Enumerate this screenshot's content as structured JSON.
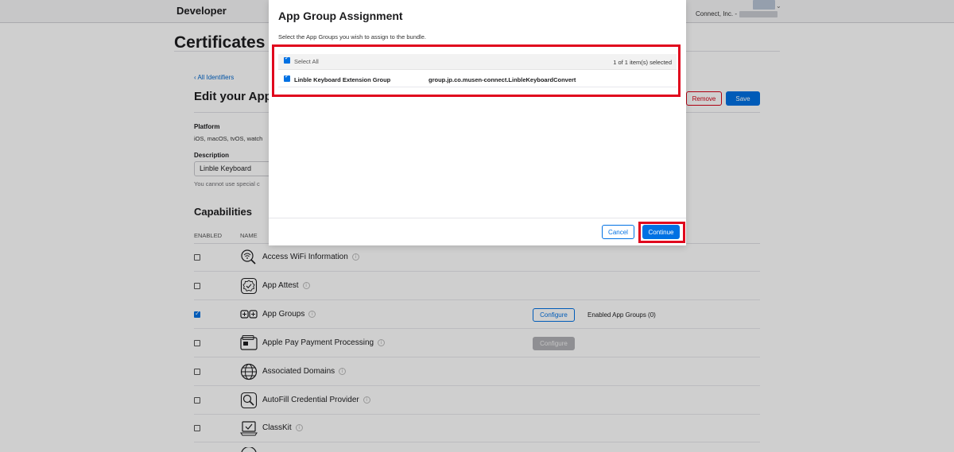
{
  "header": {
    "brand": "Developer",
    "account_text": "Connect, Inc. -"
  },
  "page": {
    "section_title": "Certificates",
    "back_link": "‹ All Identifiers",
    "edit_title": "Edit your App",
    "remove_label": "Remove",
    "save_label": "Save",
    "platform_label": "Platform",
    "platform_value": "iOS, macOS, tvOS, watch",
    "description_label": "Description",
    "description_value": "Linble Keyboard",
    "description_hint": "You cannot use special c",
    "capabilities_title": "Capabilities",
    "col_enabled": "ENABLED",
    "col_name": "NAME",
    "capabilities": [
      {
        "name": "Access WiFi Information",
        "enabled": false,
        "icon": "wifi-search-icon"
      },
      {
        "name": "App Attest",
        "enabled": false,
        "icon": "badge-check-icon"
      },
      {
        "name": "App Groups",
        "enabled": true,
        "icon": "app-groups-icon",
        "configure": "Configure",
        "extra": "Enabled App Groups (0)"
      },
      {
        "name": "Apple Pay Payment Processing",
        "enabled": false,
        "icon": "wallet-icon",
        "configure": "Configure",
        "configure_disabled": true
      },
      {
        "name": "Associated Domains",
        "enabled": false,
        "icon": "globe-icon"
      },
      {
        "name": "AutoFill Credential Provider",
        "enabled": false,
        "icon": "key-search-icon"
      },
      {
        "name": "ClassKit",
        "enabled": false,
        "icon": "classkit-icon"
      }
    ]
  },
  "modal": {
    "title": "App Group Assignment",
    "subtitle": "Select the App Groups you wish to assign to the bundle.",
    "select_all": "Select All",
    "selected_count": "1 of 1 item(s) selected",
    "groups": [
      {
        "name": "Linble Keyboard Extension Group",
        "identifier": "group.jp.co.musen-connect.LinbleKeyboardConvert",
        "checked": true
      }
    ],
    "cancel_label": "Cancel",
    "continue_label": "Continue"
  },
  "colors": {
    "accent": "#0071e3",
    "highlight": "#e0061d",
    "remove": "#d70015"
  }
}
